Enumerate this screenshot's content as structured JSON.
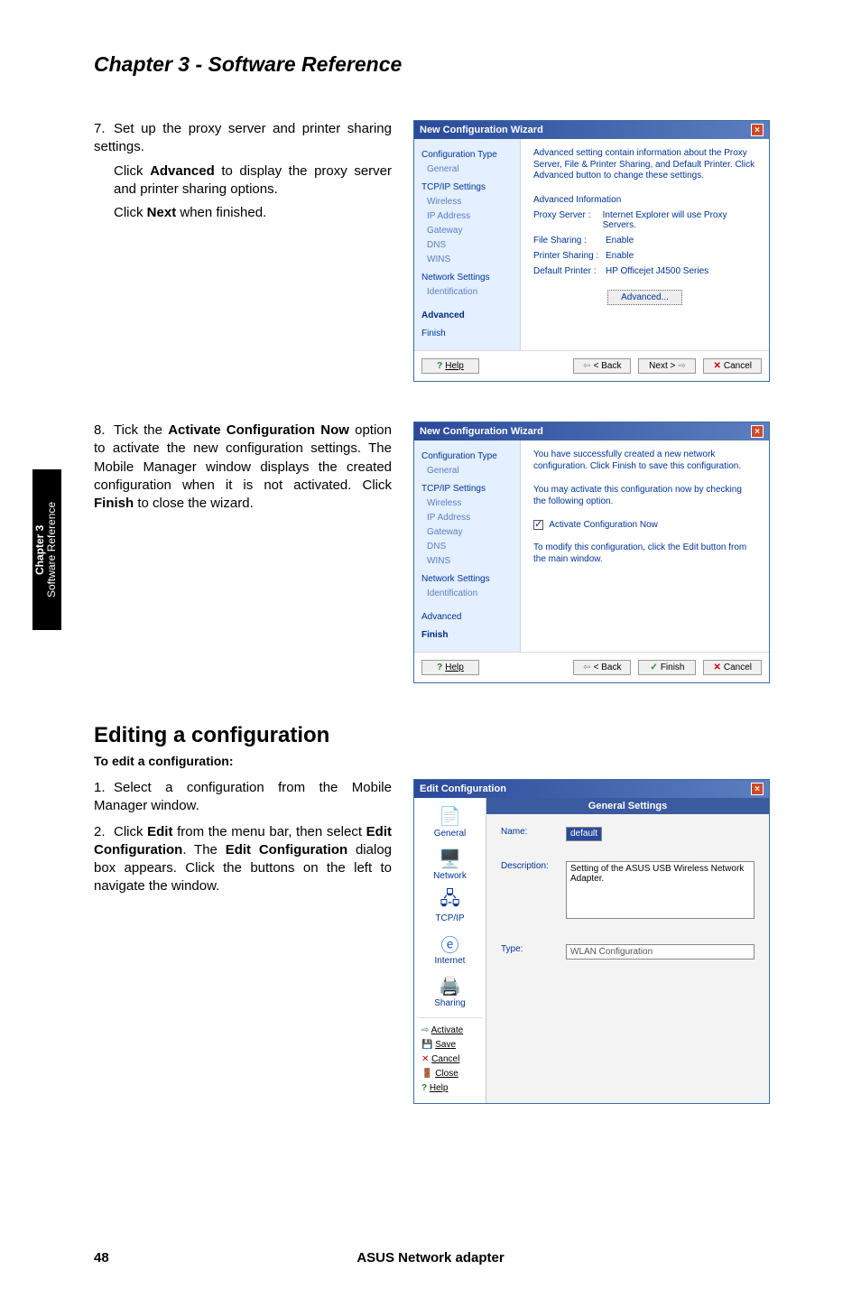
{
  "chapter_title": "Chapter 3 - Software Reference",
  "side_tab": {
    "line1": "Chapter 3",
    "line2": "Software Reference"
  },
  "footer": {
    "page": "48",
    "product": "ASUS Network adapter"
  },
  "step7": {
    "num": "7.",
    "line1": "Set up the proxy server and printer sharing settings.",
    "line2a": "Click ",
    "line2b": "Advanced",
    "line2c": " to display the proxy server and printer sharing options.",
    "line3a": "Click ",
    "line3b": "Next",
    "line3c": " when finished."
  },
  "step8": {
    "num": "8.",
    "text_a": "Tick the ",
    "text_b": "Activate Configuration Now",
    "text_c": " option to activate the new configuration settings. The Mobile Manager window displays the created configuration when it is not activated. Click ",
    "text_d": "Finish",
    "text_e": " to close the wizard."
  },
  "edit_section": {
    "heading": "Editing a configuration",
    "subheading": "To edit a configuration:",
    "step1_num": "1.",
    "step1": "Select a configuration from the Mobile Manager window.",
    "step2_num": "2.",
    "step2_a": "Click ",
    "step2_b": "Edit",
    "step2_c": " from the menu bar, then select ",
    "step2_d": "Edit Configuration",
    "step2_e": ". The ",
    "step2_f": "Edit Configuration",
    "step2_g": " dialog box appears. Click the buttons on the left to navigate the window."
  },
  "wizard7": {
    "title": "New Configuration Wizard",
    "intro": "Advanced setting contain information about the Proxy Server, File & Printer Sharing, and Default Printer. Click Advanced button to change these settings.",
    "side": {
      "conf_type": "Configuration Type",
      "general": "General",
      "tcpip": "TCP/IP Settings",
      "wireless": "Wireless",
      "ip": "IP Address",
      "gateway": "Gateway",
      "dns": "DNS",
      "wins": "WINS",
      "net": "Network Settings",
      "ident": "Identification",
      "advanced": "Advanced",
      "finish": "Finish"
    },
    "fieldset": "Advanced Information",
    "rows": {
      "proxy_k": "Proxy Server :",
      "proxy_v": "Internet Explorer will use Proxy Servers.",
      "fileshare_k": "File Sharing :",
      "fileshare_v": "Enable",
      "printshare_k": "Printer Sharing :",
      "printshare_v": "Enable",
      "defprint_k": "Default Printer :",
      "defprint_v": "HP Officejet J4500 Series"
    },
    "adv_btn": "Advanced...",
    "buttons": {
      "help": "Help",
      "back": "< Back",
      "next": "Next >",
      "cancel": "Cancel"
    }
  },
  "wizard8": {
    "title": "New Configuration Wizard",
    "intro": "You have successfully created a new network configuration. Click Finish to save this configuration.",
    "line2": "You may activate this configuration now by checking the following option.",
    "checkbox": "Activate Configuration Now",
    "line3": "To modify this configuration, click the Edit button from the main window.",
    "side": {
      "conf_type": "Configuration Type",
      "general": "General",
      "tcpip": "TCP/IP Settings",
      "wireless": "Wireless",
      "ip": "IP Address",
      "gateway": "Gateway",
      "dns": "DNS",
      "wins": "WINS",
      "net": "Network Settings",
      "ident": "Identification",
      "advanced": "Advanced",
      "finish": "Finish"
    },
    "buttons": {
      "help": "Help",
      "back": "< Back",
      "finish": "Finish",
      "cancel": "Cancel"
    }
  },
  "editconf": {
    "title": "Edit Configuration",
    "banner": "General Settings",
    "tabs": {
      "general": "General",
      "network": "Network",
      "tcpip": "TCP/IP",
      "internet": "Internet",
      "sharing": "Sharing"
    },
    "actions": {
      "activate": "Activate",
      "save": "Save",
      "cancel": "Cancel",
      "close": "Close",
      "help": "Help"
    },
    "form": {
      "name_lbl": "Name:",
      "name_val": "default",
      "desc_lbl": "Description:",
      "desc_val": "Setting of the ASUS USB Wireless Network Adapter.",
      "type_lbl": "Type:",
      "type_val": "WLAN Configuration"
    }
  }
}
